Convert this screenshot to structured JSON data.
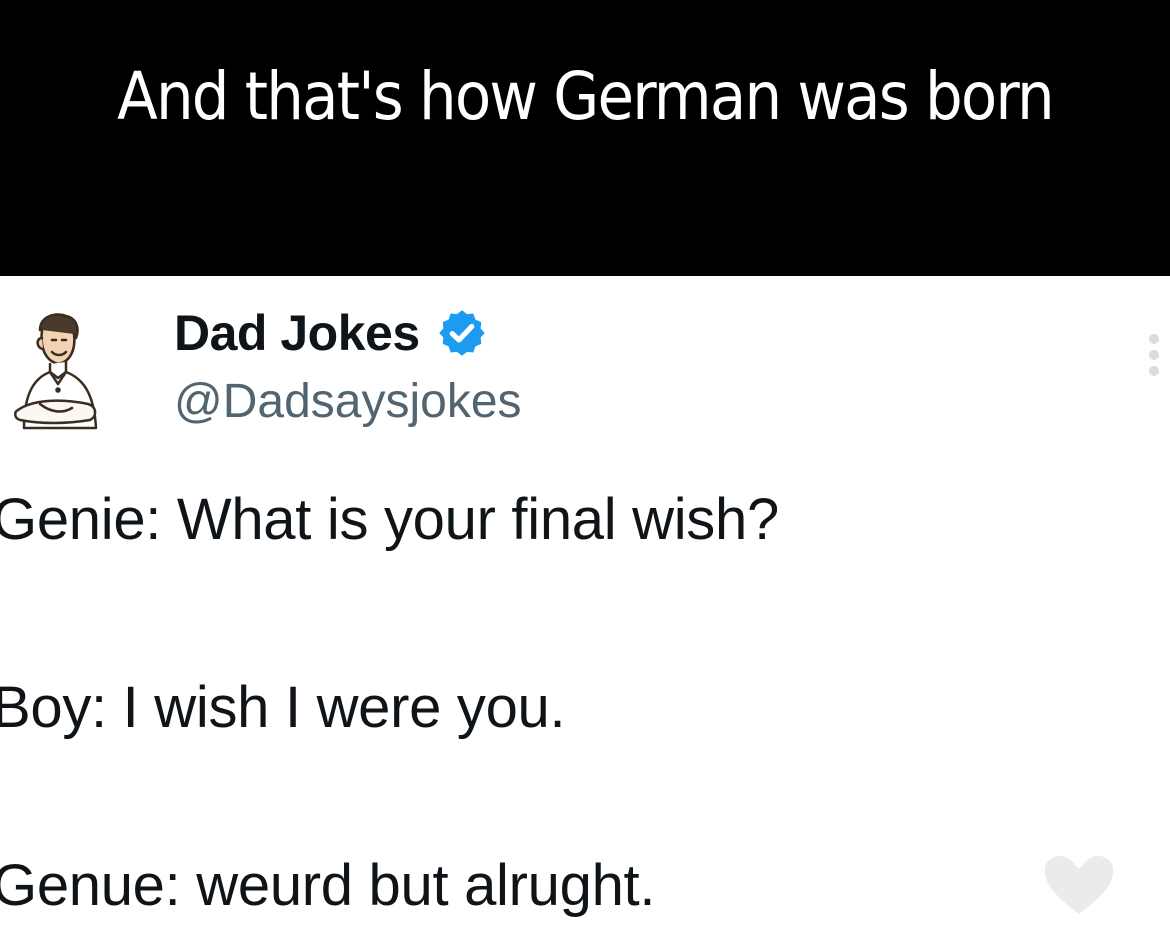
{
  "caption": {
    "text": "And that's how German was born"
  },
  "tweet": {
    "author": {
      "name": "Dad Jokes",
      "handle": "@Dadsaysjokes",
      "verified": true,
      "avatar_icon": "cartoon-man-avatar"
    },
    "lines": [
      "Genie: What is your final wish?",
      "Boy: I wish I were you.",
      "Genue: weurd but alrught."
    ],
    "more_icon": "vertical-ellipsis-icon",
    "like_icon": "heart-outline-icon"
  },
  "colors": {
    "caption_bg": "#000000",
    "caption_text": "#ffffff",
    "name": "#0f1419",
    "handle": "#536471",
    "verified": "#1d9bf0",
    "body_text": "#0f1419"
  }
}
